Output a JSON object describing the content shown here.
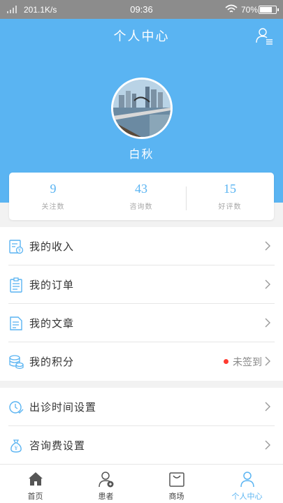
{
  "status_bar": {
    "speed": "201.1K/s",
    "time": "09:36",
    "battery_pct": "70%",
    "battery_level": 0.7
  },
  "header": {
    "title": "个人中心",
    "user_menu_icon": "user-list-icon"
  },
  "profile": {
    "name": "白秋",
    "avatar": "city-bridge-photo"
  },
  "stats": [
    {
      "value": "9",
      "label": "关注数"
    },
    {
      "value": "43",
      "label": "咨询数"
    },
    {
      "value": "15",
      "label": "好评数"
    }
  ],
  "menu_group_1": [
    {
      "label": "我的收入",
      "icon": "income-document-icon"
    },
    {
      "label": "我的订单",
      "icon": "order-clipboard-icon"
    },
    {
      "label": "我的文章",
      "icon": "article-icon"
    },
    {
      "label": "我的积分",
      "icon": "points-coins-icon",
      "status": "未签到"
    }
  ],
  "menu_group_2": [
    {
      "label": "出诊时间设置",
      "icon": "clock-check-icon"
    },
    {
      "label": "咨询费设置",
      "icon": "money-bag-icon"
    }
  ],
  "tabs": [
    {
      "label": "首页",
      "icon": "home-icon",
      "active": false
    },
    {
      "label": "患者",
      "icon": "patient-icon",
      "active": false
    },
    {
      "label": "商场",
      "icon": "shopping-bag-icon",
      "active": false
    },
    {
      "label": "个人中心",
      "icon": "person-icon",
      "active": true
    }
  ],
  "colors": {
    "accent": "#5ab4f2",
    "status_bar": "#8c8c8c",
    "badge": "#ff3b30",
    "background": "#f2f2f2"
  }
}
